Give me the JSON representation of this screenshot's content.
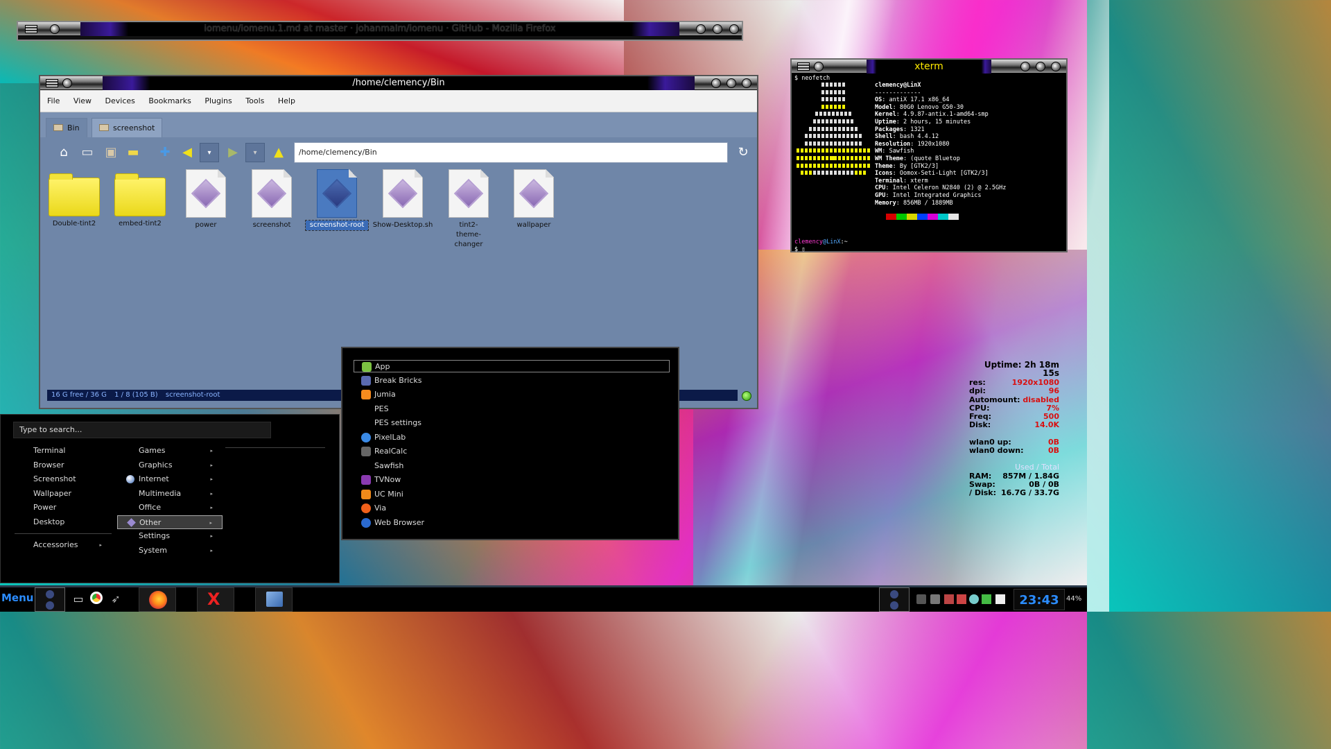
{
  "firefox": {
    "title": "iomenu/iomenu.1.md at master · johanmalm/iomenu · GitHub - Mozilla Firefox"
  },
  "filemanager": {
    "title": "/home/clemency/Bin",
    "menus": [
      "File",
      "View",
      "Devices",
      "Bookmarks",
      "Plugins",
      "Tools",
      "Help"
    ],
    "tabs": [
      "Bin",
      "screenshot"
    ],
    "address": "/home/clemency/Bin",
    "items": [
      {
        "label": "Double-tint2",
        "kind": "folder"
      },
      {
        "label": "embed-tint2",
        "kind": "folder"
      },
      {
        "label": "power",
        "kind": "script"
      },
      {
        "label": "screenshot",
        "kind": "script"
      },
      {
        "label": "screenshot-root",
        "kind": "script",
        "selected": true
      },
      {
        "label": "Show-Desktop.sh",
        "kind": "script"
      },
      {
        "label": "tint2-theme-changer",
        "kind": "script"
      },
      {
        "label": "wallpaper",
        "kind": "script"
      }
    ],
    "status": {
      "free": "16 G free / 36 G",
      "count": "1 / 8 (105 B)",
      "selection": "screenshot-root"
    }
  },
  "xterm": {
    "title": "xterm",
    "command": "$ neofetch",
    "userhost": "clemency@LinX",
    "underline": "-------------",
    "info": [
      {
        "k": "OS",
        "v": "antiX 17.1 x86_64"
      },
      {
        "k": "Model",
        "v": "80G0 Lenovo G50-30"
      },
      {
        "k": "Kernel",
        "v": "4.9.87-antix.1-amd64-smp"
      },
      {
        "k": "Uptime",
        "v": "2 hours, 15 minutes"
      },
      {
        "k": "Packages",
        "v": "1321"
      },
      {
        "k": "Shell",
        "v": "bash 4.4.12"
      },
      {
        "k": "Resolution",
        "v": "1920x1080"
      },
      {
        "k": "WM",
        "v": "Sawfish"
      },
      {
        "k": "WM Theme",
        "v": "(quote Bluetop"
      },
      {
        "k": "Theme",
        "v": "By [GTK2/3]"
      },
      {
        "k": "Icons",
        "v": "Oomox-Seti-Light [GTK2/3]"
      },
      {
        "k": "Terminal",
        "v": "xterm"
      },
      {
        "k": "CPU",
        "v": "Intel Celeron N2840 (2) @ 2.5GHz"
      },
      {
        "k": "GPU",
        "v": "Intel Integrated Graphics"
      },
      {
        "k": "Memory",
        "v": "856MB / 1889MB"
      }
    ],
    "prompt_user": "clemency",
    "prompt_host": "@LinX",
    "prompt_path": ":~",
    "prompt": "$ ▯",
    "swatches": [
      "#d60000",
      "#00c800",
      "#d6d600",
      "#0040ff",
      "#d600d6",
      "#00c8c8",
      "#e6e6e6"
    ]
  },
  "conky": {
    "uptime": "Uptime: 2h 18m 15s",
    "rows1": [
      {
        "k": "res:",
        "v": "1920x1080"
      },
      {
        "k": "dpi:",
        "v": "96"
      },
      {
        "k": "Automount:",
        "v": "disabled"
      },
      {
        "k": "CPU:",
        "v": "7%"
      },
      {
        "k": "Freq:",
        "v": "500"
      },
      {
        "k": "Disk:",
        "v": "14.0K"
      }
    ],
    "rows2": [
      {
        "k": "wlan0 up:",
        "v": "0B"
      },
      {
        "k": "wlan0 down:",
        "v": "0B"
      }
    ],
    "header": "Used / Total",
    "rows3": [
      {
        "k": "RAM:",
        "v": "857M    / 1.84G"
      },
      {
        "k": "Swap:",
        "v": "0B     / 0B"
      },
      {
        "k": "/ Disk:",
        "v": "16.7G   / 33.7G"
      }
    ]
  },
  "appmenu": {
    "search_placeholder": "Type to search...",
    "left": [
      "Terminal",
      "Browser",
      "Screenshot",
      "Wallpaper",
      "Power",
      "Desktop"
    ],
    "left_extra": "Accessories",
    "categories": [
      "Games",
      "Graphics",
      "Internet",
      "Multimedia",
      "Office",
      "Other",
      "Settings",
      "System"
    ],
    "active_category": "Other"
  },
  "submenu": {
    "items": [
      {
        "label": "App",
        "icon": "android-icon",
        "color": "#7cc242"
      },
      {
        "label": "Break Bricks",
        "icon": "bricks-icon",
        "color": "#5a6ab0"
      },
      {
        "label": "Jumia",
        "icon": "jumia-icon",
        "color": "#f68b1e"
      },
      {
        "label": "PES",
        "icon": "",
        "color": ""
      },
      {
        "label": "PES settings",
        "icon": "",
        "color": ""
      },
      {
        "label": "PixelLab",
        "icon": "pixellab-icon",
        "color": "#3a8ae6"
      },
      {
        "label": "RealCalc",
        "icon": "calculator-icon",
        "color": "#666666"
      },
      {
        "label": "Sawfish",
        "icon": "",
        "color": ""
      },
      {
        "label": "TVNow",
        "icon": "tvnow-icon",
        "color": "#8a3ab0"
      },
      {
        "label": "UC Mini",
        "icon": "ucmini-icon",
        "color": "#f08a1a"
      },
      {
        "label": "Via",
        "icon": "via-icon",
        "color": "#f0601a"
      },
      {
        "label": "Web Browser",
        "icon": "globe-icon",
        "color": "#2a6ad0"
      }
    ]
  },
  "taskbar": {
    "menu_label": "Menu",
    "clock": "23:43",
    "battery": "44%"
  }
}
